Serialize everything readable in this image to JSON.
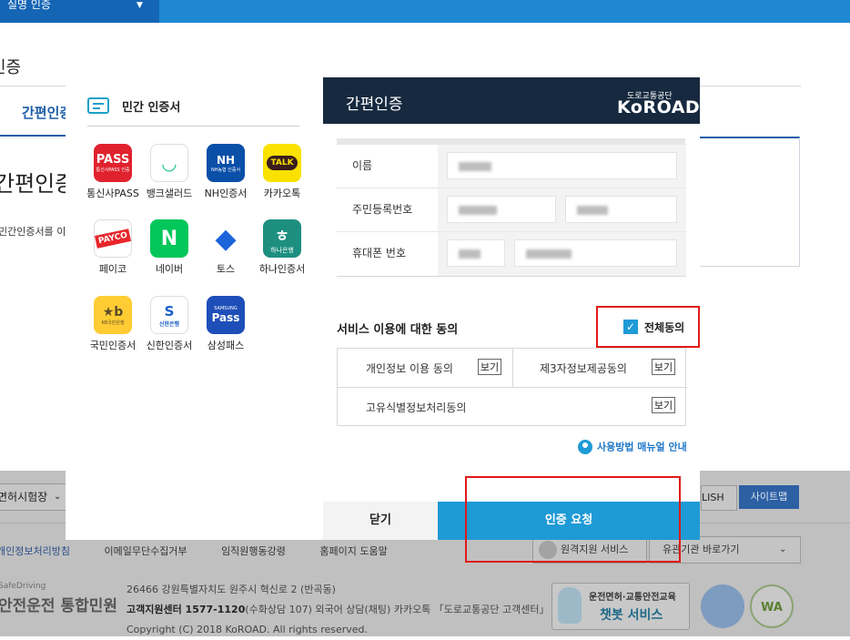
{
  "topbar": {
    "tab_label": "실명 인증",
    "caret": "▼"
  },
  "page": {
    "title": "인증",
    "tab": "간편인증",
    "heading": "간편인증",
    "desc": "민간인증서를 이"
  },
  "footer": {
    "select_label": "면허시험장",
    "english": "LISH",
    "sitemap": "사이트맵",
    "links": [
      "개인정보처리방침",
      "이메일무단수집거부",
      "임직원행동강령",
      "홈페이지 도움말"
    ],
    "remote": "원격지원 서비스",
    "related": "유관기관 바로가기",
    "logo_small": "SafeDriving",
    "logo": "안전운전 통합민원",
    "address": "26466 강원특별자치도 원주시 혁신로 2 (반곡동)",
    "center_label": "고객지원센터 1577-1120",
    "center_detail": "(수화상담 107) 외국어 상담(채팅) 카카오톡 「도로교통공단 고객센터」 채널",
    "copyright": "Copyright (C) 2018 KoROAD. All rights reserved.",
    "chatbot_line1": "운전면허·교통안전교육",
    "chatbot_line2": "챗봇 서비스",
    "badge2": "WA"
  },
  "cert_panel": {
    "title": "민간 인증서",
    "items": [
      {
        "name": "통신사PASS",
        "logo": "PASS",
        "logo_sub": "통신사PASS 인증",
        "color": "#e0222e"
      },
      {
        "name": "뱅크샐러드",
        "logo": "◡",
        "color": "#ffffff"
      },
      {
        "name": "NH인증서",
        "logo": "NH",
        "logo_sub": "NH농협 인증서",
        "color": "#0a4fa8"
      },
      {
        "name": "카카오톡",
        "logo": "TALK",
        "color": "#fae100"
      },
      {
        "name": "페이코",
        "logo": "PAYCO",
        "color": "#ffffff"
      },
      {
        "name": "네이버",
        "logo": "N",
        "color": "#03c75a"
      },
      {
        "name": "토스",
        "logo": "◆",
        "color": "#ffffff"
      },
      {
        "name": "하나인증서",
        "logo": "ㅎ",
        "logo_sub": "하나은행",
        "color": "#1d8f80"
      },
      {
        "name": "국민인증서",
        "logo": "★b",
        "logo_sub": "KB국민은행",
        "color": "#ffcc33"
      },
      {
        "name": "신한인증서",
        "logo": "S",
        "logo_sub": "신한은행",
        "color": "#ffffff"
      },
      {
        "name": "삼성패스",
        "logo": "Pass",
        "logo_sub": "SAMSUNG",
        "color": "#1e4fb8"
      }
    ]
  },
  "modal": {
    "title": "간편인증",
    "brand_small": "도로교통공단",
    "brand": "KoROAD",
    "fields": [
      {
        "label": "이름"
      },
      {
        "label": "주민등록번호"
      },
      {
        "label": "휴대폰 번호"
      }
    ],
    "consent_title": "서비스 이용에 대한 동의",
    "agree_all": "전체동의",
    "check_mark": "✓",
    "consents": [
      {
        "label": "개인정보 이용 동의",
        "view": "보기"
      },
      {
        "label": "제3자정보제공동의",
        "view": "보기"
      },
      {
        "label": "고유식별정보처리동의",
        "view": "보기"
      }
    ],
    "manual": "사용방법 매뉴얼 안내",
    "close": "닫기",
    "request": "인증 요청"
  }
}
